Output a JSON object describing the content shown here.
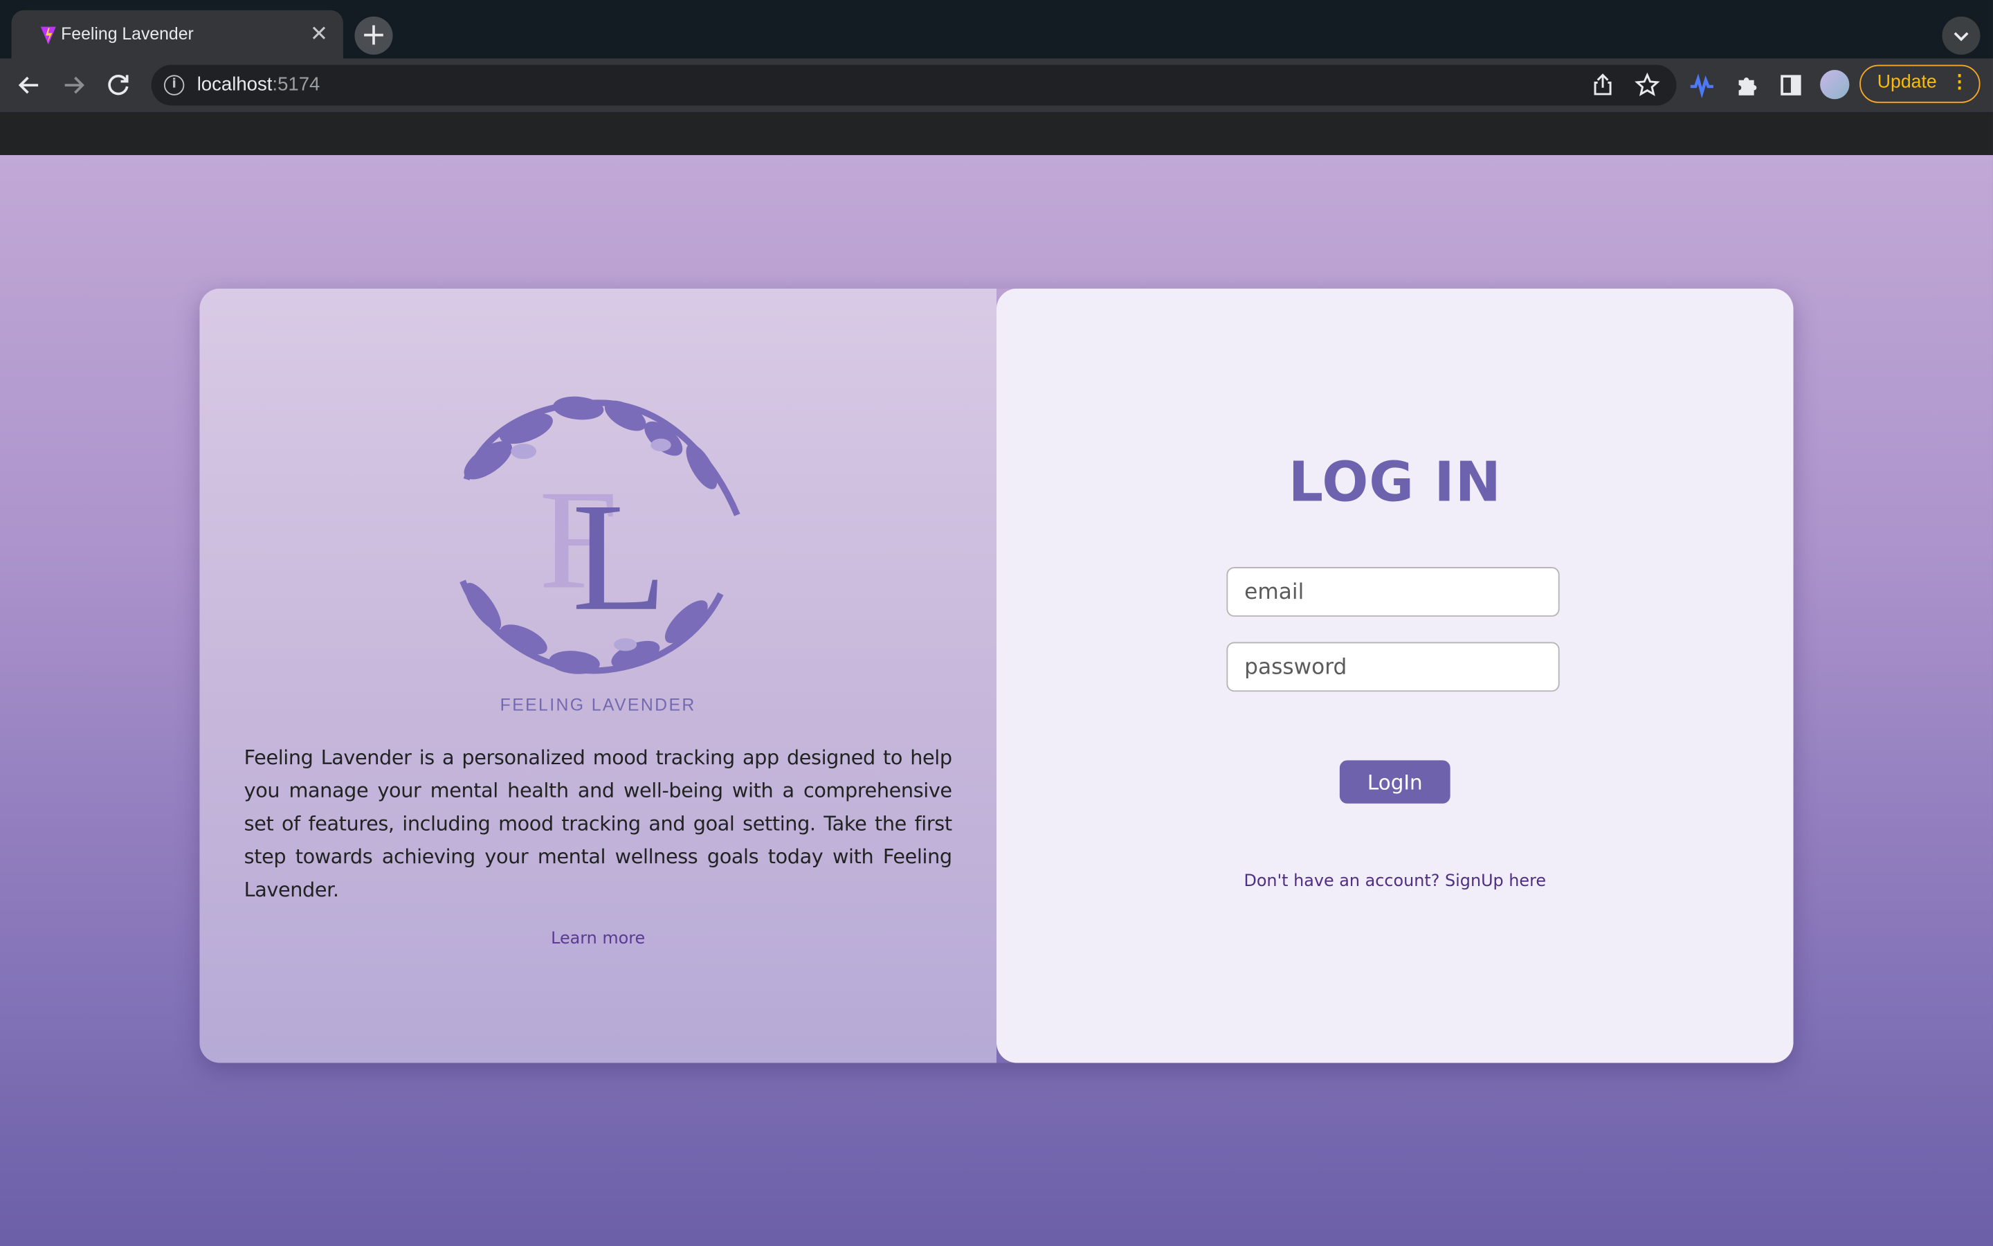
{
  "browser": {
    "tab_title": "Feeling Lavender",
    "url_host": "localhost",
    "url_port": ":5174",
    "update_label": "Update",
    "icons": [
      "favicon-icon",
      "close-tab-icon",
      "new-tab-icon",
      "back-icon",
      "forward-icon",
      "reload-icon",
      "info-icon",
      "share-icon",
      "bookmark-star-icon",
      "extension-wave-icon",
      "puzzle-icon",
      "sidepanel-icon",
      "profile-avatar",
      "menu-dots-icon"
    ]
  },
  "brand": {
    "name": "FEELING LAVENDER",
    "description": "Feeling Lavender is a personalized mood tracking app designed to help you manage your mental health and well-being with a comprehensive set of features, including mood tracking and goal setting. Take the first step towards achieving your mental wellness goals today with Feeling Lavender.",
    "learn_more": "Learn more"
  },
  "login": {
    "title": "LOG IN",
    "email_placeholder": "email",
    "password_placeholder": "password",
    "submit_label": "LogIn",
    "signup_text": "Don't have an account? SignUp here"
  },
  "colors": {
    "accent": "#6e62ad",
    "page_bottom": "#6b5fa8",
    "page_top": "#c1a8d6",
    "panel": "#f1edf9"
  }
}
